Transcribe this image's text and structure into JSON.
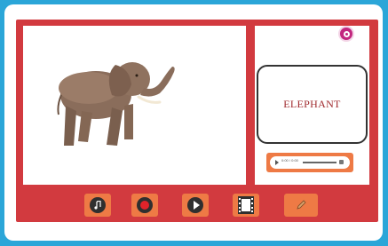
{
  "card": {
    "word": "ELEPHANT",
    "image_subject": "elephant"
  },
  "audio": {
    "time": "0:00 / 0:00"
  },
  "toolbar": {
    "buttons": [
      {
        "icon": "music-note-icon"
      },
      {
        "icon": "record-icon"
      },
      {
        "icon": "play-icon"
      },
      {
        "icon": "film-strip-icon"
      },
      {
        "icon": "pencil-icon"
      }
    ]
  },
  "settings": {
    "icon": "gear-icon"
  },
  "colors": {
    "background": "#2ba6d8",
    "board": "#d23a3f",
    "button": "#ee7a45",
    "accent": "#c2277f",
    "word": "#a02a2e"
  }
}
